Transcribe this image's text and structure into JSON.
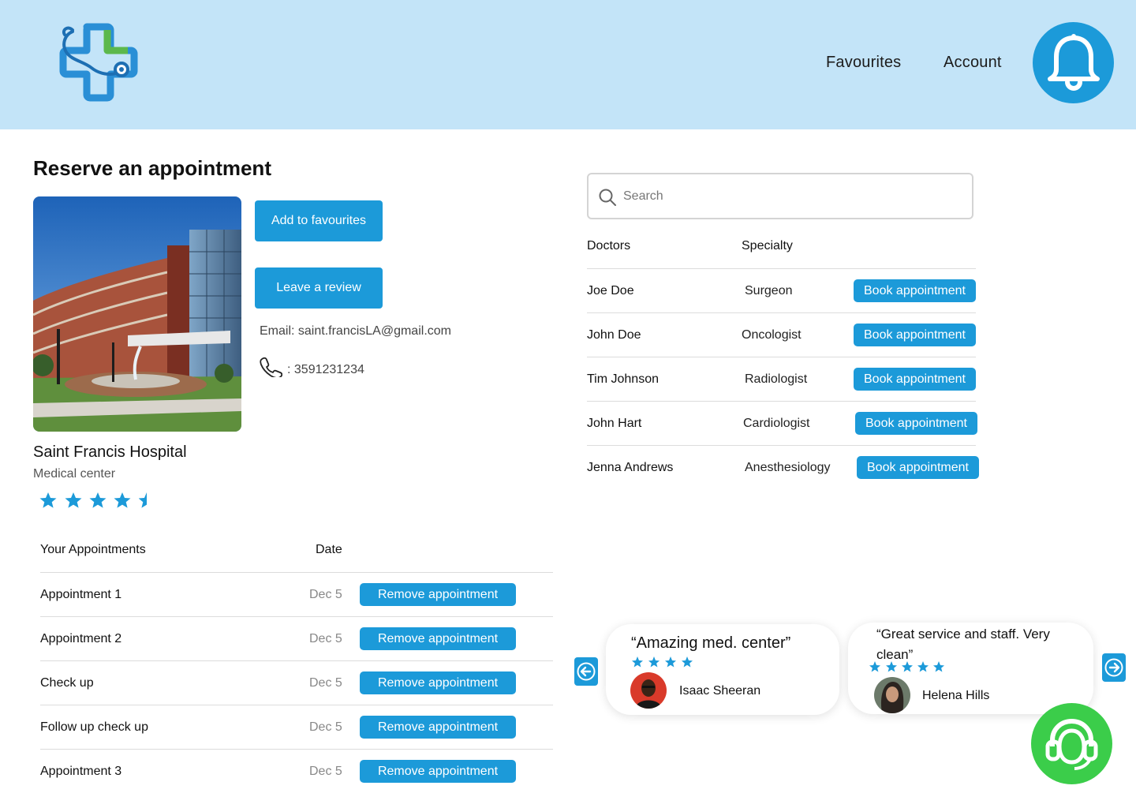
{
  "header": {
    "logo_icon": "medical-cross-stethoscope-icon",
    "nav": [
      "Favourites",
      "Account"
    ],
    "bell_icon": "bell-icon"
  },
  "page": {
    "title": "Reserve an appointment"
  },
  "hospital": {
    "name": "Saint Francis Hospital",
    "type": "Medical center",
    "rating": 4.5,
    "email": "Email: saint.francisLA@gmail.com",
    "phone": ": 3591231234",
    "add_favourites": "Add to favourites",
    "leave_review": "Leave a review"
  },
  "appointments": {
    "header": {
      "name": "Your Appointments",
      "date": "Date"
    },
    "action_label": "Remove appointment",
    "rows": [
      {
        "name": "Appointment 1",
        "date": "Dec 5"
      },
      {
        "name": "Appointment 2",
        "date": "Dec 5"
      },
      {
        "name": "Check up",
        "date": "Dec 5"
      },
      {
        "name": "Follow up check up",
        "date": "Dec 5"
      },
      {
        "name": "Appointment 3",
        "date": "Dec 5"
      }
    ]
  },
  "search": {
    "placeholder": "Search"
  },
  "doctors": {
    "header": {
      "name": "Doctors",
      "specialty": "Specialty"
    },
    "action_label": "Book appointment",
    "rows": [
      {
        "name": "Joe Doe",
        "specialty": "Surgeon"
      },
      {
        "name": "John Doe",
        "specialty": "Oncologist"
      },
      {
        "name": "Tim Johnson",
        "specialty": "Radiologist"
      },
      {
        "name": "John Hart",
        "specialty": "Cardiologist"
      },
      {
        "name": "Jenna Andrews",
        "specialty": "Anesthesiology"
      }
    ]
  },
  "reviews": [
    {
      "quote": "“Amazing med. center”",
      "stars": 4,
      "reviewer": "Isaac Sheeran"
    },
    {
      "quote": "“Great service and staff. Very clean”",
      "stars": 5,
      "reviewer": "Helena Hills"
    }
  ],
  "colors": {
    "header_bg": "#c3e4f8",
    "accent_blue": "#1c9ad9",
    "support_green": "#3bcd4a",
    "logo_green": "#5cb84c"
  },
  "support_icon": "headset-support-icon"
}
